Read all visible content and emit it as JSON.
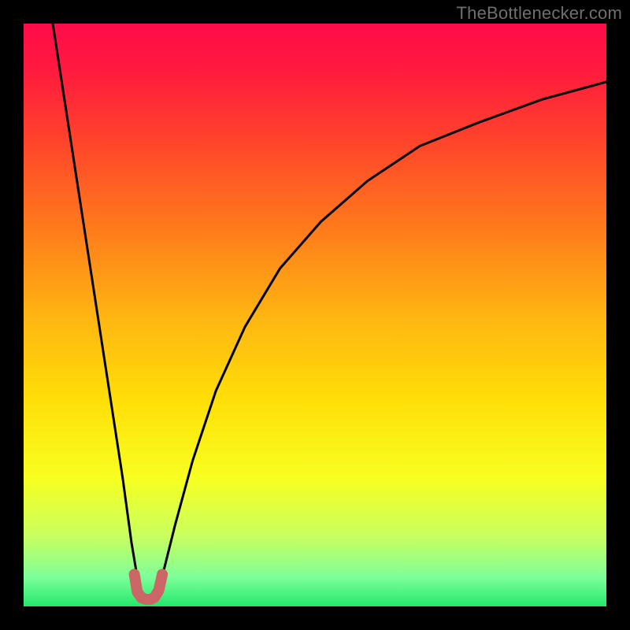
{
  "watermark": "TheBottlenecker.com",
  "colors": {
    "frame": "#000000",
    "curve": "#000000",
    "dip_marker": "#cc6666",
    "gradient_stops": [
      {
        "offset": 0.0,
        "color": "#ff0b49"
      },
      {
        "offset": 0.08,
        "color": "#ff1a3e"
      },
      {
        "offset": 0.2,
        "color": "#ff432b"
      },
      {
        "offset": 0.35,
        "color": "#ff7a1c"
      },
      {
        "offset": 0.5,
        "color": "#ffb412"
      },
      {
        "offset": 0.65,
        "color": "#ffe008"
      },
      {
        "offset": 0.78,
        "color": "#f7ff20"
      },
      {
        "offset": 0.88,
        "color": "#c8ff60"
      },
      {
        "offset": 0.95,
        "color": "#7dff9a"
      },
      {
        "offset": 1.0,
        "color": "#22e86b"
      }
    ]
  },
  "chart_data": {
    "type": "line",
    "title": "",
    "xlabel": "",
    "ylabel": "",
    "xlim": [
      0,
      100
    ],
    "ylim": [
      0,
      100
    ],
    "annotations": [],
    "series": [
      {
        "name": "bottleneck-curve-left",
        "x": [
          5,
          7,
          9,
          11,
          13,
          15,
          17,
          18.5,
          19.5,
          20.2
        ],
        "values": [
          100,
          87,
          74,
          61,
          48,
          35,
          22,
          11,
          5,
          2
        ]
      },
      {
        "name": "bottleneck-curve-right",
        "x": [
          22.8,
          24,
          26,
          29,
          33,
          38,
          44,
          51,
          59,
          68,
          78,
          89,
          100
        ],
        "values": [
          2,
          6,
          14,
          25,
          37,
          48,
          58,
          66,
          73,
          79,
          83,
          87,
          90
        ]
      },
      {
        "name": "dip-marker",
        "x": [
          19.0,
          19.5,
          20.2,
          21.0,
          21.8,
          22.5,
          23.2,
          23.8
        ],
        "values": [
          5.5,
          2.5,
          1.5,
          1.2,
          1.2,
          1.6,
          2.8,
          5.5
        ]
      }
    ],
    "dip_x": 21.5
  }
}
